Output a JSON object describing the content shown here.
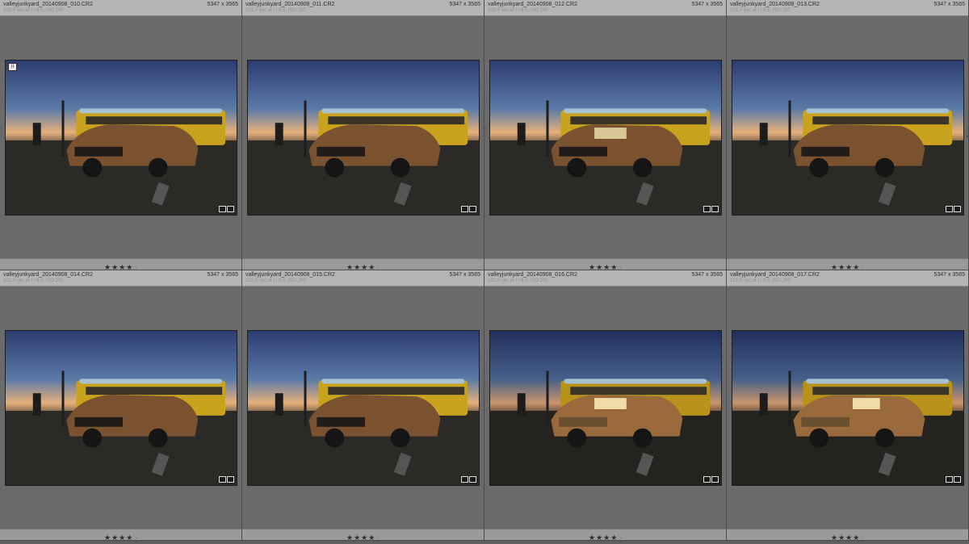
{
  "grid": {
    "items": [
      {
        "filename": "valleyjunkyard_20140908_010.CR2",
        "dimensions": "5347 x 3565",
        "exif": "201.0 sec at f / 9.5, ISO 200",
        "rating": "★★★★",
        "dot": "·",
        "flag": "II"
      },
      {
        "filename": "valleyjunkyard_20140908_011.CR2",
        "dimensions": "5347 x 3565",
        "exif": "201.0 sec at f / 9.5, ISO 200",
        "rating": "★★★★",
        "dot": "·",
        "flag": ""
      },
      {
        "filename": "valleyjunkyard_20140908_012.CR2",
        "dimensions": "5347 x 3565",
        "exif": "201.0 sec at f / 9.5, ISO 200",
        "rating": "★★★★",
        "dot": "·",
        "flag": ""
      },
      {
        "filename": "valleyjunkyard_20140908_013.CR2",
        "dimensions": "5347 x 3565",
        "exif": "201.0 sec at f / 9.5, ISO 200",
        "rating": "★★★★",
        "dot": "·",
        "flag": ""
      },
      {
        "filename": "valleyjunkyard_20140908_014.CR2",
        "dimensions": "5347 x 3565",
        "exif": "201.0 sec at f / 9.5, ISO 200",
        "rating": "★★★★",
        "dot": "·",
        "flag": ""
      },
      {
        "filename": "valleyjunkyard_20140908_015.CR2",
        "dimensions": "5347 x 3565",
        "exif": "201.0 sec at f / 9.5, ISO 200",
        "rating": "★★★★",
        "dot": "·",
        "flag": ""
      },
      {
        "filename": "valleyjunkyard_20140908_016.CR2",
        "dimensions": "5347 x 3565",
        "exif": "122.0 sec at f / 9.5, ISO 200",
        "rating": "★★★★",
        "dot": "·",
        "flag": ""
      },
      {
        "filename": "valleyjunkyard_20140908_017.CR2",
        "dimensions": "5347 x 3565",
        "exif": "120.0 sec at f / 9.5, ISO 200",
        "rating": "★★★★",
        "dot": "·",
        "flag": ""
      }
    ],
    "arrow": "›",
    "colors": {
      "cell_bg": "#6a6a6a",
      "header_bg": "#b5b5b5",
      "footer_bg": "#9a9a9a",
      "sky_top": "#2b3a6e",
      "sky_horizon": "#e8a86a",
      "bus": "#c9a31e",
      "car": "#7a5230"
    }
  }
}
